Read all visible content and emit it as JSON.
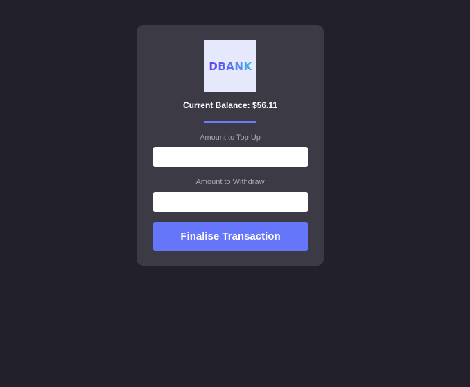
{
  "logo": {
    "text": "DBANK",
    "colors": [
      "#5b3ff2",
      "#5a6cf0",
      "#3fb5ea"
    ],
    "background": "#e6e8fb"
  },
  "balance": {
    "text": "Current Balance: $56.11"
  },
  "form": {
    "topup_label": "Amount to Top Up",
    "topup_value": "",
    "withdraw_label": "Amount to Withdraw",
    "withdraw_value": "",
    "submit_label": "Finalise Transaction"
  },
  "colors": {
    "page_background": "#21202b",
    "card_background": "#3b3a45",
    "accent": "#6576fb"
  }
}
